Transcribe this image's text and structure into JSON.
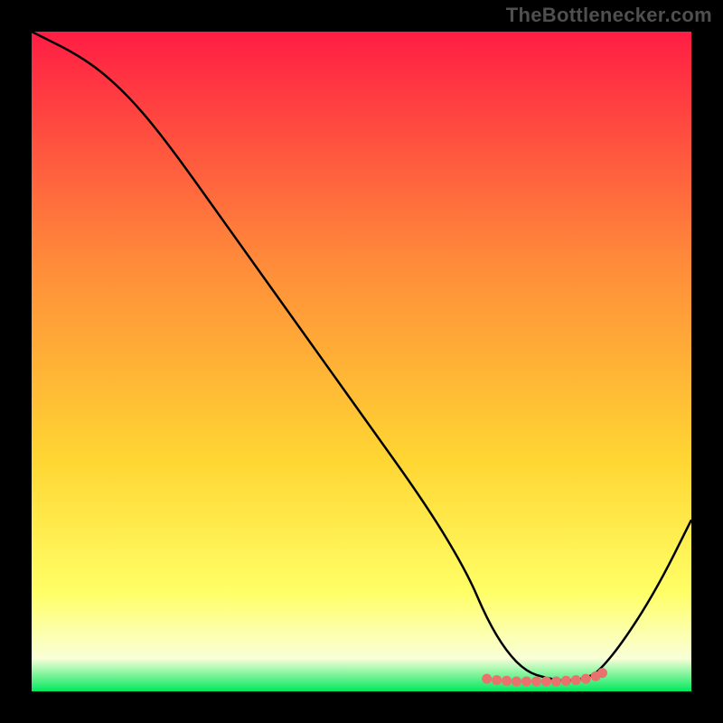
{
  "watermark": "TheBottlenecker.com",
  "gradient": {
    "top": "#ff1d44",
    "mid1": "#ff8b3a",
    "mid2": "#ffd633",
    "low": "#ffff66",
    "pale": "#faffd8",
    "bottom": "#00e85c"
  },
  "chart_data": {
    "type": "line",
    "title": "",
    "xlabel": "",
    "ylabel": "",
    "xlim": [
      0,
      100
    ],
    "ylim": [
      0,
      100
    ],
    "series": [
      {
        "name": "curve",
        "x": [
          0,
          8,
          14,
          20,
          30,
          40,
          50,
          60,
          66,
          69,
          72,
          75,
          78,
          81,
          84,
          86,
          90,
          95,
          100
        ],
        "values": [
          100,
          96,
          91,
          84,
          70,
          56,
          42,
          28,
          18,
          11,
          6,
          3,
          2,
          1.5,
          2,
          3,
          8,
          16,
          26
        ]
      }
    ],
    "flat_zone": {
      "x_start": 69,
      "x_end": 86,
      "y": 1.6
    },
    "dots": [
      {
        "x": 69.0,
        "y": 1.9
      },
      {
        "x": 70.5,
        "y": 1.7
      },
      {
        "x": 72.0,
        "y": 1.6
      },
      {
        "x": 73.5,
        "y": 1.5
      },
      {
        "x": 75.0,
        "y": 1.5
      },
      {
        "x": 76.5,
        "y": 1.5
      },
      {
        "x": 78.0,
        "y": 1.5
      },
      {
        "x": 79.5,
        "y": 1.5
      },
      {
        "x": 81.0,
        "y": 1.6
      },
      {
        "x": 82.5,
        "y": 1.7
      },
      {
        "x": 84.0,
        "y": 1.9
      },
      {
        "x": 85.5,
        "y": 2.3
      },
      {
        "x": 86.5,
        "y": 2.8
      }
    ],
    "colors": {
      "curve": "#000000",
      "dots": "#e9716e"
    }
  }
}
